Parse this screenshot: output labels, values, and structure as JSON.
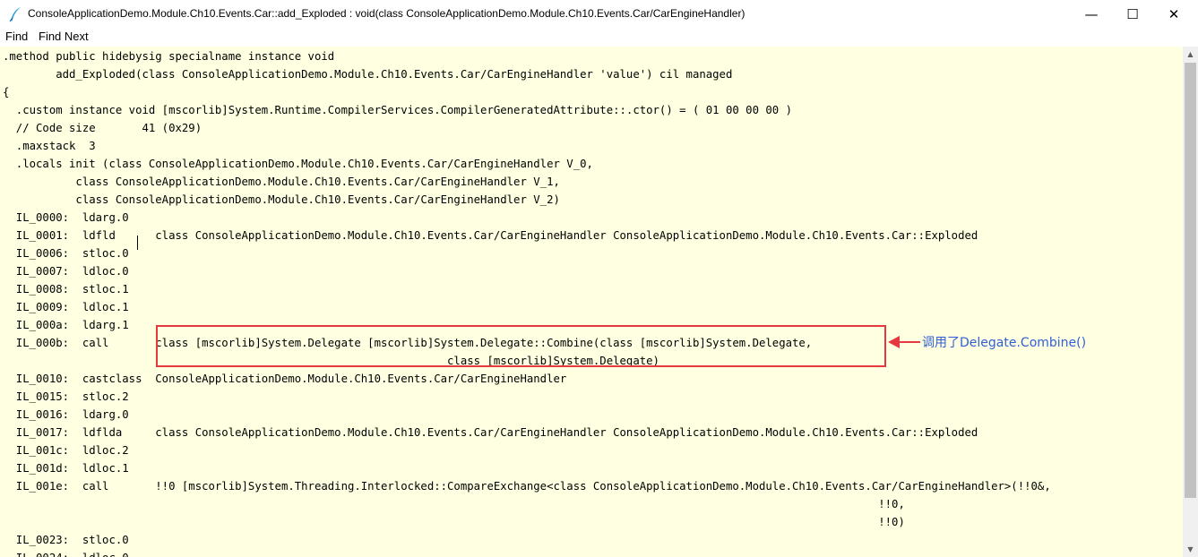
{
  "window": {
    "title": "ConsoleApplicationDemo.Module.Ch10.Events.Car::add_Exploded : void(class ConsoleApplicationDemo.Module.Ch10.Events.Car/CarEngineHandler)",
    "minimize_glyph": "—",
    "maximize_glyph": "☐",
    "close_glyph": "✕",
    "icon": "feather-pen-icon",
    "icon_color": "#1a9ad6"
  },
  "menu": {
    "find": "Find",
    "find_next": "Find Next"
  },
  "editor": {
    "background": "#ffffe1",
    "code": ".method public hidebysig specialname instance void\n        add_Exploded(class ConsoleApplicationDemo.Module.Ch10.Events.Car/CarEngineHandler 'value') cil managed\n{\n  .custom instance void [mscorlib]System.Runtime.CompilerServices.CompilerGeneratedAttribute::.ctor() = ( 01 00 00 00 )\n  // Code size       41 (0x29)\n  .maxstack  3\n  .locals init (class ConsoleApplicationDemo.Module.Ch10.Events.Car/CarEngineHandler V_0,\n           class ConsoleApplicationDemo.Module.Ch10.Events.Car/CarEngineHandler V_1,\n           class ConsoleApplicationDemo.Module.Ch10.Events.Car/CarEngineHandler V_2)\n  IL_0000:  ldarg.0\n  IL_0001:  ldfld      class ConsoleApplicationDemo.Module.Ch10.Events.Car/CarEngineHandler ConsoleApplicationDemo.Module.Ch10.Events.Car::Exploded\n  IL_0006:  stloc.0\n  IL_0007:  ldloc.0\n  IL_0008:  stloc.1\n  IL_0009:  ldloc.1\n  IL_000a:  ldarg.1\n  IL_000b:  call       class [mscorlib]System.Delegate [mscorlib]System.Delegate::Combine(class [mscorlib]System.Delegate,\n                                                                   class [mscorlib]System.Delegate)\n  IL_0010:  castclass  ConsoleApplicationDemo.Module.Ch10.Events.Car/CarEngineHandler\n  IL_0015:  stloc.2\n  IL_0016:  ldarg.0\n  IL_0017:  ldflda     class ConsoleApplicationDemo.Module.Ch10.Events.Car/CarEngineHandler ConsoleApplicationDemo.Module.Ch10.Events.Car::Exploded\n  IL_001c:  ldloc.2\n  IL_001d:  ldloc.1\n  IL_001e:  call       !!0 [mscorlib]System.Threading.Interlocked::CompareExchange<class ConsoleApplicationDemo.Module.Ch10.Events.Car/CarEngineHandler>(!!0&,\n                                                                                                                                    !!0,\n                                                                                                                                    !!0)\n  IL_0023:  stloc.0\n  IL_0024:  ldloc.0"
  },
  "annotation": {
    "text": "调用了Delegate.Combine()",
    "box_color": "#e6393f",
    "text_color": "#2f5fd6"
  },
  "scrollbar": {
    "up_glyph": "▲",
    "down_glyph": "▼"
  }
}
